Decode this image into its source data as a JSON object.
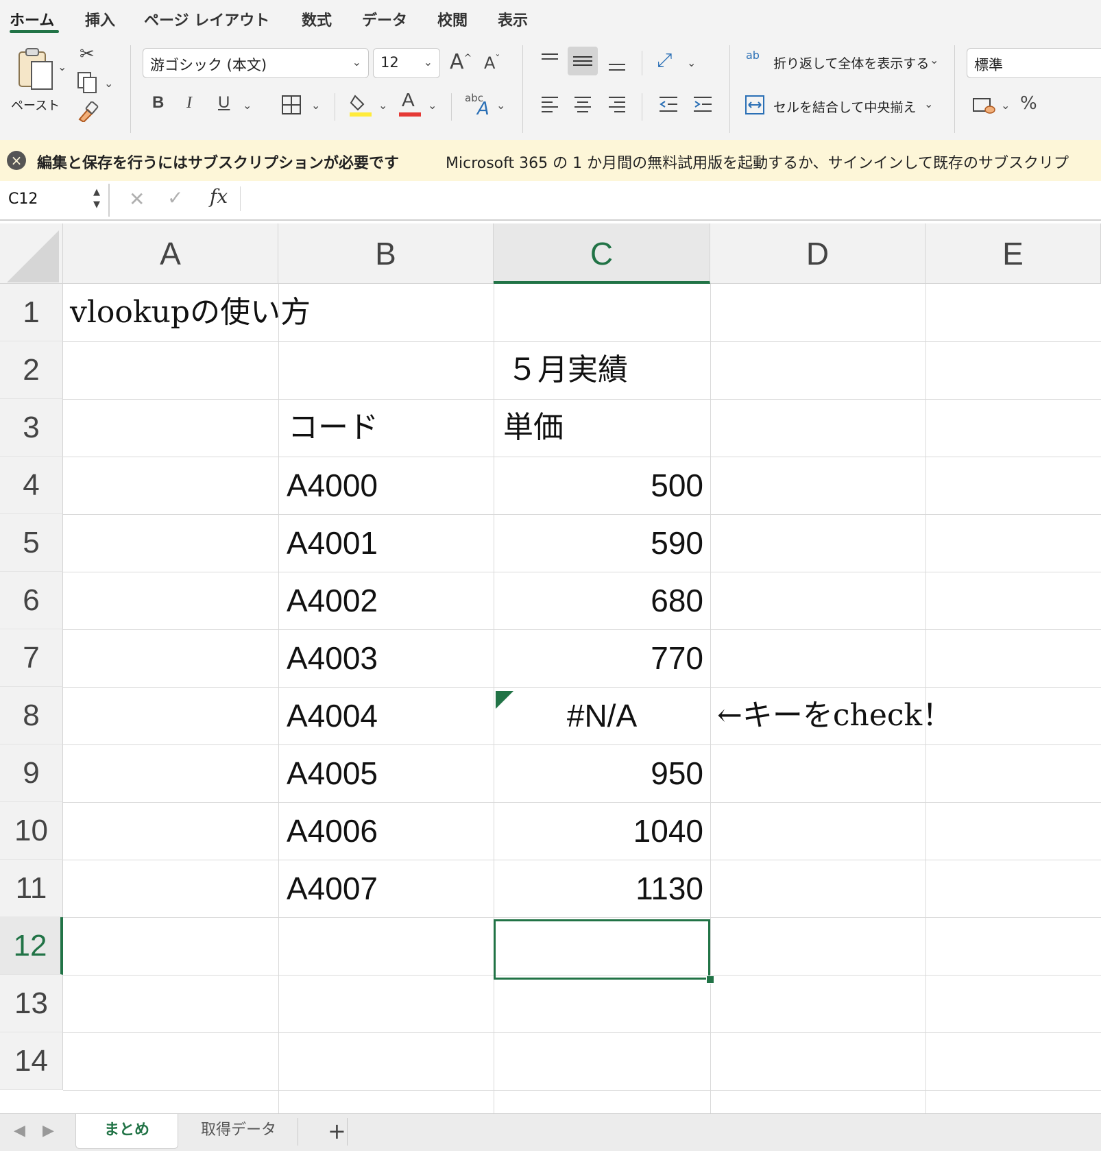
{
  "ribbon": {
    "tabs": [
      "ホーム",
      "挿入",
      "ページ レイアウト",
      "数式",
      "データ",
      "校閲",
      "表示"
    ],
    "active_tab": "ホーム"
  },
  "toolbar": {
    "paste_label": "ペースト",
    "font_name": "游ゴシック (本文)",
    "font_size": "12",
    "bold": "B",
    "italic": "I",
    "underline": "U",
    "font_color_glyph": "A",
    "grow_font": "A",
    "shrink_font": "A",
    "abc_label": "abc",
    "ab_label": "ab",
    "wrap_text_label": "折り返して全体を表示する",
    "merge_center_label": "セルを結合して中央揃え",
    "number_format": "標準",
    "colors": {
      "accent": "#217346",
      "fill_highlight": "#ffeb3b",
      "font_color": "#e53935"
    }
  },
  "message_bar": {
    "title": "編集と保存を行うにはサブスクリプションが必要です",
    "body": "Microsoft 365 の 1 か月間の無料試用版を起動するか、サインインして既存のサブスクリプ"
  },
  "formula_bar": {
    "name_box": "C12",
    "fx": "fx",
    "formula": ""
  },
  "grid": {
    "columns": [
      "A",
      "B",
      "C",
      "D",
      "E"
    ],
    "selected_column": "C",
    "rows": [
      "1",
      "2",
      "3",
      "4",
      "5",
      "6",
      "7",
      "8",
      "9",
      "10",
      "11",
      "12",
      "13",
      "14"
    ],
    "selected_row": "12",
    "cells": {
      "A1": "vlookupの使い方",
      "C2": "５月実績",
      "B3": "コード",
      "C3": "単価",
      "B4": "A4000",
      "C4": "500",
      "B5": "A4001",
      "C5": "590",
      "B6": "A4002",
      "C6": "680",
      "B7": "A4003",
      "C7": "770",
      "B8": "A4004",
      "C8": "#N/A",
      "D8": "←キーをcheck！",
      "B9": "A4005",
      "C9": "950",
      "B10": "A4006",
      "C10": "1040",
      "B11": "A4007",
      "C11": "1130"
    }
  },
  "sheets": {
    "tabs": [
      "まとめ",
      "取得データ"
    ],
    "active": "まとめ",
    "add_label": "+"
  }
}
